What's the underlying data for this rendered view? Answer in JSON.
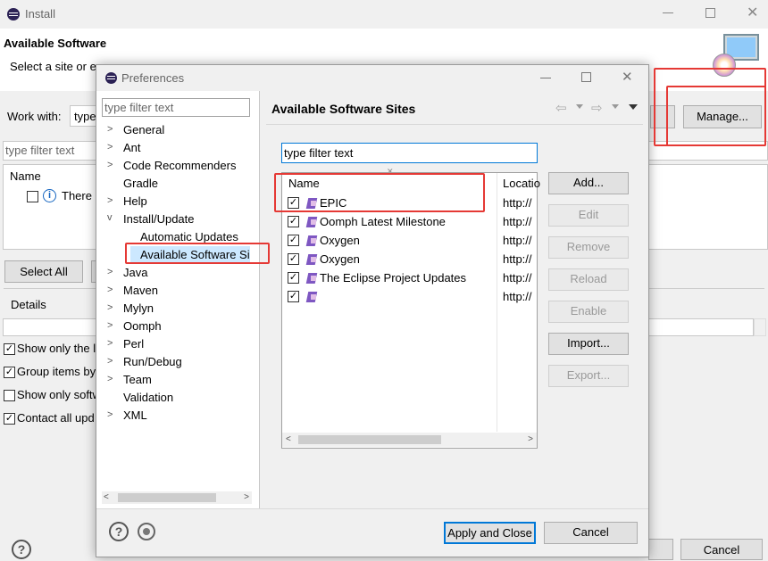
{
  "install": {
    "title": "Install",
    "heading": "Available Software",
    "subtitle": "Select a site or enter the location of a site.",
    "work_with_label": "Work with:",
    "work_with_value": "type",
    "manage_label": "Manage...",
    "filter_placeholder": "type filter text",
    "name_col": "Name",
    "there_text": "There i",
    "select_all": "Select All",
    "details": "Details",
    "options": [
      "Show only the l",
      "Group items by",
      "Show only softw",
      "Contact all upd"
    ],
    "cancel": "Cancel"
  },
  "prefs": {
    "title": "Preferences",
    "filter_placeholder": "type filter text",
    "tree": [
      {
        "label": "General",
        "chevron": ">"
      },
      {
        "label": "Ant",
        "chevron": ">"
      },
      {
        "label": "Code Recommenders",
        "chevron": ">"
      },
      {
        "label": "Gradle",
        "chevron": ""
      },
      {
        "label": "Help",
        "chevron": ">"
      },
      {
        "label": "Install/Update",
        "chevron": "v"
      },
      {
        "label": "Automatic Updates",
        "chevron": ""
      },
      {
        "label": "Available Software Sit",
        "chevron": ""
      },
      {
        "label": "Java",
        "chevron": ">"
      },
      {
        "label": "Maven",
        "chevron": ">"
      },
      {
        "label": "Mylyn",
        "chevron": ">"
      },
      {
        "label": "Oomph",
        "chevron": ">"
      },
      {
        "label": "Perl",
        "chevron": ">"
      },
      {
        "label": "Run/Debug",
        "chevron": ">"
      },
      {
        "label": "Team",
        "chevron": ">"
      },
      {
        "label": "Validation",
        "chevron": ""
      },
      {
        "label": "XML",
        "chevron": ">"
      }
    ],
    "page_title": "Available Software Sites",
    "sites_filter": "type filter text",
    "col_name": "Name",
    "col_location": "Locatio",
    "sites": [
      {
        "name": "EPIC",
        "location": "http://"
      },
      {
        "name": "Oomph Latest Milestone",
        "location": "http://"
      },
      {
        "name": "Oxygen",
        "location": "http://"
      },
      {
        "name": "Oxygen",
        "location": "http://"
      },
      {
        "name": "The Eclipse Project Updates",
        "location": "http://"
      },
      {
        "name": "",
        "location": "http://"
      }
    ],
    "buttons": {
      "add": "Add...",
      "edit": "Edit",
      "remove": "Remove",
      "reload": "Reload",
      "enable": "Enable",
      "import": "Import...",
      "export": "Export..."
    },
    "apply_close": "Apply and Close",
    "cancel": "Cancel"
  },
  "colors": {
    "highlight": "#e53935",
    "accent": "#0078d7"
  }
}
